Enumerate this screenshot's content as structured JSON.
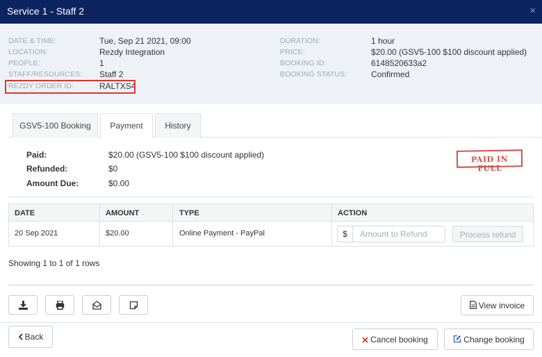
{
  "window": {
    "title": "Service 1 - Staff 2",
    "close_glyph": "×"
  },
  "info": {
    "left": [
      {
        "label": "DATE & TIME:",
        "value": "Tue, Sep 21 2021, 09:00"
      },
      {
        "label": "LOCATION:",
        "value": "Rezdy Integration"
      },
      {
        "label": "PEOPLE:",
        "value": "1"
      },
      {
        "label": "STAFF/RESOURCES:",
        "value": "Staff 2"
      },
      {
        "label": "REZDY ORDER ID:",
        "value": "RALTXS4"
      }
    ],
    "right": [
      {
        "label": "DURATION:",
        "value": "1 hour"
      },
      {
        "label": "PRICE:",
        "value": "$20.00 (GSV5-100 $100 discount applied)"
      },
      {
        "label": "BOOKING ID:",
        "value": "6148520633a2"
      },
      {
        "label": "BOOKING STATUS:",
        "value": "Confirmed"
      }
    ]
  },
  "tabs": [
    {
      "label": "GSV5-100 Booking",
      "active": false
    },
    {
      "label": "Payment",
      "active": true
    },
    {
      "label": "History",
      "active": false
    }
  ],
  "summary": {
    "paid_label": "Paid:",
    "paid_value": "$20.00 (GSV5-100 $100 discount applied)",
    "refunded_label": "Refunded:",
    "refunded_value": "$0",
    "due_label": "Amount Due:",
    "due_value": "$0.00"
  },
  "stamp": "PAID IN FULL",
  "table": {
    "headers": [
      "DATE",
      "AMOUNT",
      "TYPE",
      "ACTION"
    ],
    "rows": [
      {
        "date": "20 Sep 2021",
        "amount": "$20.00",
        "type": "Online Payment - PayPal"
      }
    ]
  },
  "refund": {
    "currency": "$",
    "placeholder": "Amount to Refund",
    "button": "Process refund"
  },
  "rows_info": "Showing 1 to 1 of 1 rows",
  "toolbar_icons": [
    "download-icon",
    "print-icon",
    "email-icon",
    "note-icon"
  ],
  "buttons": {
    "view_invoice": "View invoice",
    "back": "Back",
    "cancel_booking": "Cancel booking",
    "change_booking": "Change booking"
  },
  "colors": {
    "titlebar": "#0c2460",
    "highlight": "#e0342a",
    "stamp": "#c6332b",
    "cancel_x": "#d9342b",
    "link": "#2d62c8"
  }
}
